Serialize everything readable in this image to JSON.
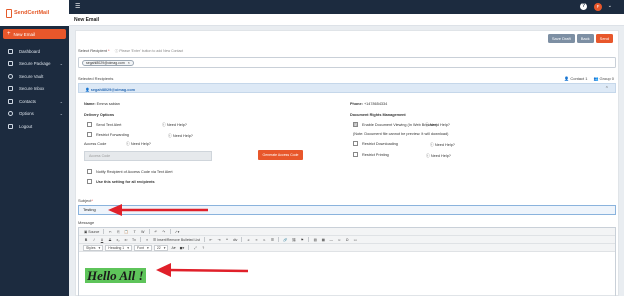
{
  "app": {
    "logo_text": "SendCertMail",
    "new_email_button": "New Email",
    "page_title": "New Email"
  },
  "sidebar": {
    "items": [
      {
        "label": "Dashboard",
        "icon": "dashboard-icon",
        "has_chevron": false
      },
      {
        "label": "Secure Package",
        "icon": "package-icon",
        "has_chevron": true
      },
      {
        "label": "Secure Vault",
        "icon": "vault-icon",
        "has_chevron": false
      },
      {
        "label": "Secure Inbox",
        "icon": "inbox-icon",
        "has_chevron": false
      },
      {
        "label": "Contacts",
        "icon": "contacts-icon",
        "has_chevron": true
      },
      {
        "label": "Options",
        "icon": "gear-icon",
        "has_chevron": true
      },
      {
        "label": "Logout",
        "icon": "logout-icon",
        "has_chevron": false
      }
    ],
    "chevron": "⌄"
  },
  "topbar": {
    "help_glyph": "?",
    "avatar_initial": "F",
    "chevron": "⌄"
  },
  "actions": {
    "save_draft": "Save Draft",
    "back": "Back",
    "send": "Send"
  },
  "recipient": {
    "label": "Select Recipient",
    "required_mark": "*",
    "hint": "Please 'Enter' button to add New Contact",
    "chip_email": "segahl8029@oimag.com",
    "chip_remove": "×"
  },
  "selected_recipients": {
    "label": "Selected Recipients",
    "contact_count": "Contact 1",
    "group_count": "Group 0",
    "email": "segahl8029@oimag.com"
  },
  "details": {
    "name_label": "Name:",
    "name_value": "Emma sabian",
    "phone_label": "Phone:",
    "phone_value": "+1478654334",
    "delivery_heading": "Delivery Options",
    "send_text_alert": "Send Text Alert",
    "restrict_forwarding": "Restrict Forwarding",
    "access_code_label": "Access Code",
    "access_code_placeholder": "Access Code",
    "generate_button": "Generate Access Code",
    "notify_access_code": "Notify Recipient of Access Code via Text Alert",
    "use_for_all": "Use this setting for all recipients",
    "drm_heading": "Document Rights Management",
    "enable_web_viewing": "Enable Document Viewing (In Web Browser)",
    "drm_note": "(Note: Document file cannot be preview. It will download)",
    "restrict_downloading": "Restrict Downloading",
    "restrict_printing": "Restrict Printing",
    "need_help": "Need Help?"
  },
  "subject": {
    "label": "Subject",
    "required_mark": "*",
    "value": "Testing"
  },
  "message": {
    "label": "Message",
    "body": "Hello All !",
    "toolbar": {
      "source": "Source",
      "paragraph_format": "Heading 1",
      "font": "Font",
      "size": "22",
      "insert_remove_list": "Insert/Remove Bulleted List",
      "styles": "Styles"
    }
  },
  "colors": {
    "sidebar": "#1c2b3f",
    "accent": "#e8572b",
    "highlight": "#5ec45a",
    "annotation_arrow": "#e0202a"
  }
}
